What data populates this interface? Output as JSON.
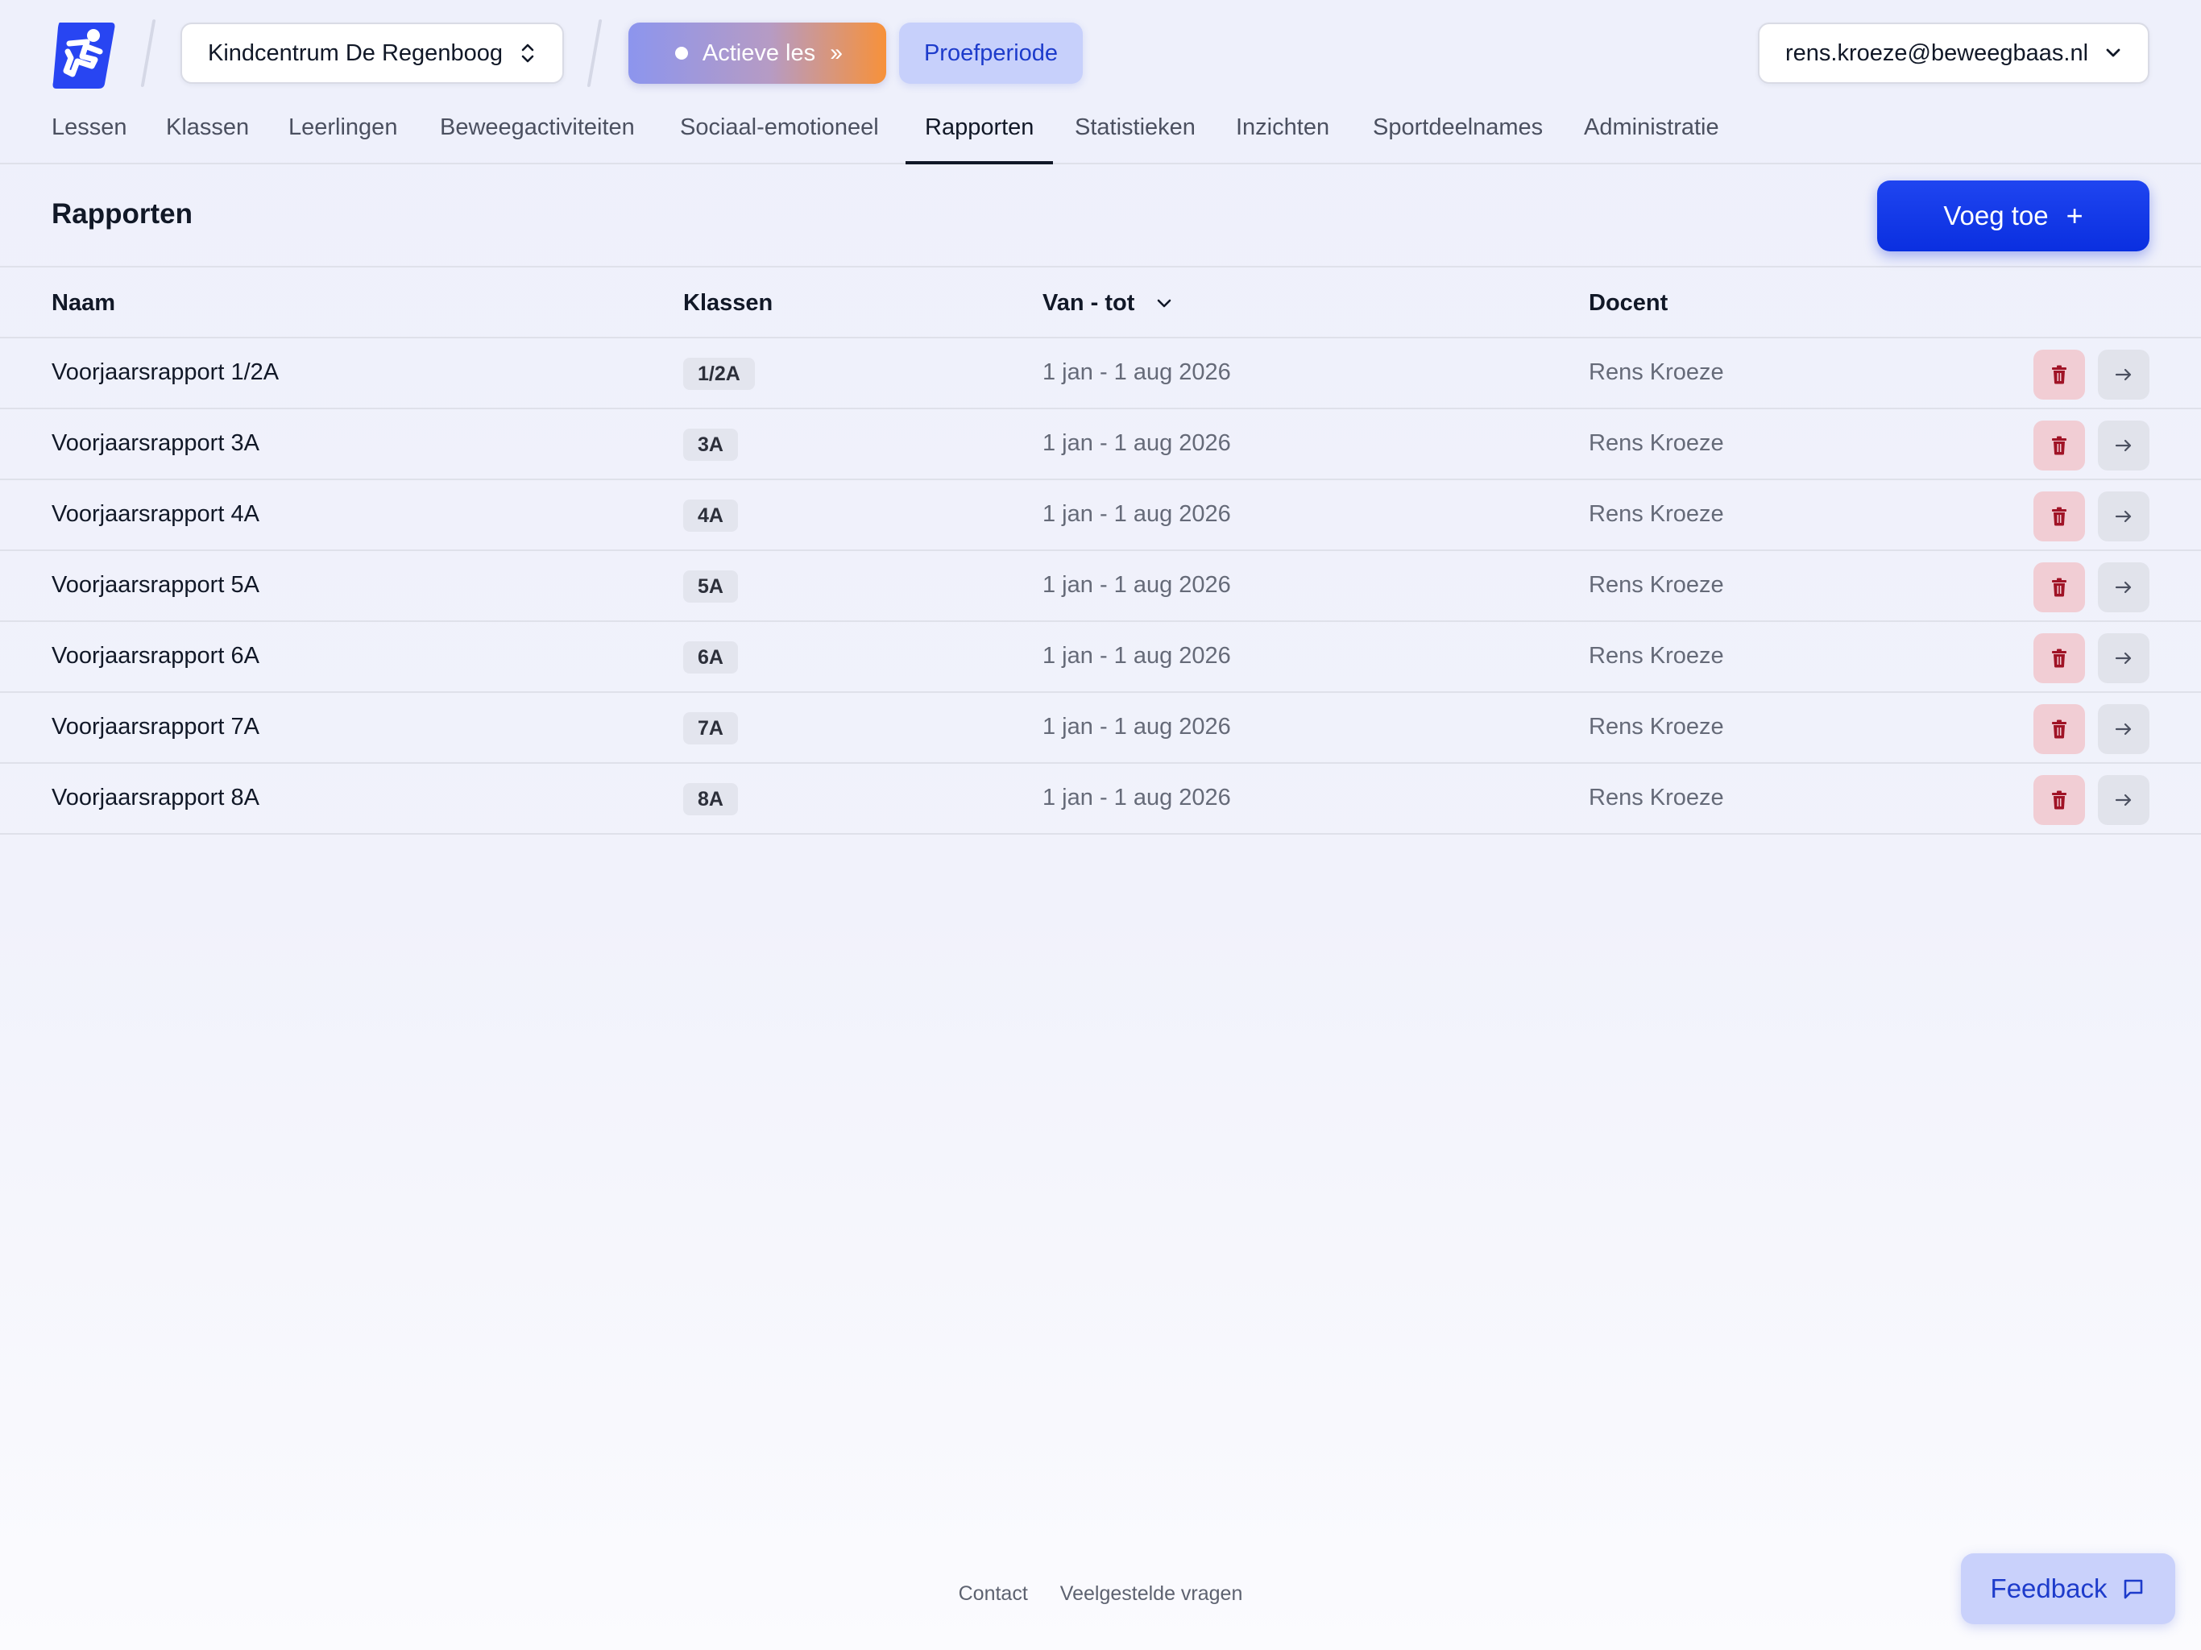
{
  "header": {
    "logo_icon": "runner-logo-icon",
    "organization": "Kindcentrum De Regenboog",
    "active_lesson_label": "Actieve les",
    "trial_label": "Proefperiode",
    "user_email": "rens.kroeze@beweegbaas.nl"
  },
  "nav": {
    "items": [
      {
        "label": "Lessen"
      },
      {
        "label": "Klassen"
      },
      {
        "label": "Leerlingen"
      },
      {
        "label": "Beweegactiviteiten"
      },
      {
        "label": "Sociaal-emotioneel"
      },
      {
        "label": "Rapporten"
      },
      {
        "label": "Statistieken"
      },
      {
        "label": "Inzichten"
      },
      {
        "label": "Sportdeelnames"
      },
      {
        "label": "Administratie"
      }
    ],
    "active": "Rapporten"
  },
  "page": {
    "title": "Rapporten",
    "add_label": "Voeg toe",
    "add_icon": "+"
  },
  "table": {
    "columns": {
      "name": "Naam",
      "classes": "Klassen",
      "period": "Van - tot",
      "teacher": "Docent"
    },
    "rows": [
      {
        "name": "Voorjaarsrapport 1/2A",
        "class": "1/2A",
        "period": "1 jan - 1 aug 2026",
        "teacher": "Rens Kroeze"
      },
      {
        "name": "Voorjaarsrapport 3A",
        "class": "3A",
        "period": "1 jan - 1 aug 2026",
        "teacher": "Rens Kroeze"
      },
      {
        "name": "Voorjaarsrapport 4A",
        "class": "4A",
        "period": "1 jan - 1 aug 2026",
        "teacher": "Rens Kroeze"
      },
      {
        "name": "Voorjaarsrapport 5A",
        "class": "5A",
        "period": "1 jan - 1 aug 2026",
        "teacher": "Rens Kroeze"
      },
      {
        "name": "Voorjaarsrapport 6A",
        "class": "6A",
        "period": "1 jan - 1 aug 2026",
        "teacher": "Rens Kroeze"
      },
      {
        "name": "Voorjaarsrapport 7A",
        "class": "7A",
        "period": "1 jan - 1 aug 2026",
        "teacher": "Rens Kroeze"
      },
      {
        "name": "Voorjaarsrapport 8A",
        "class": "8A",
        "period": "1 jan - 1 aug 2026",
        "teacher": "Rens Kroeze"
      }
    ]
  },
  "footer": {
    "contact": "Contact",
    "faq": "Veelgestelde vragen",
    "feedback": "Feedback"
  },
  "colors": {
    "primary": "#0a2fe0",
    "danger_bg": "#f1cdd4",
    "danger_icon": "#a01326"
  }
}
